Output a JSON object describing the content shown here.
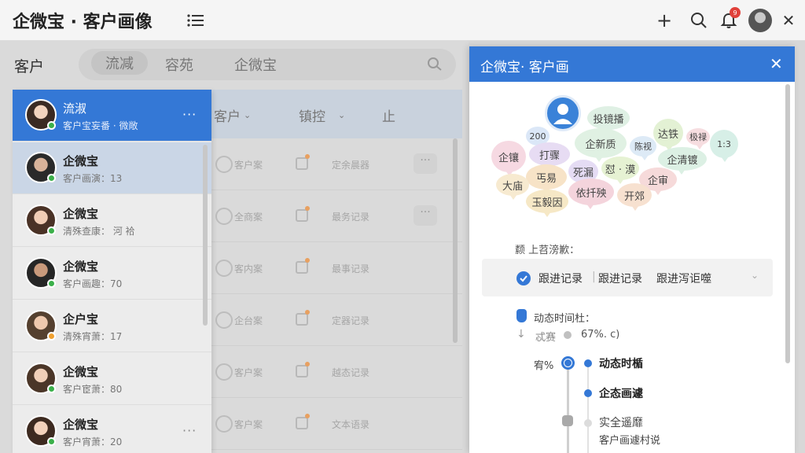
{
  "app": {
    "title": "企微宝 · 客户画像"
  },
  "topbar": {
    "bell_badge": "9"
  },
  "main": {
    "section_label": "客户",
    "tabs": [
      {
        "label": "流减",
        "active": true
      },
      {
        "label": "容苑",
        "active": false
      },
      {
        "label": "企微宝",
        "active": false
      }
    ],
    "table_headers": [
      "客户",
      "镇控",
      "止"
    ],
    "rows": [
      {
        "col1": "客户案",
        "col2": "定余晨器"
      },
      {
        "col1": "全商案",
        "col2": "最务记录"
      },
      {
        "col1": "客内案",
        "col2": "最事记录"
      },
      {
        "col1": "企台案",
        "col2": "定器记录"
      },
      {
        "col1": "客户案",
        "col2": "越态记录"
      },
      {
        "col1": "客户案",
        "col2": "文本语录"
      }
    ]
  },
  "customers": [
    {
      "name": "流淑",
      "sub": "客户宝妄番 · 微敞",
      "status": "green",
      "selected": true
    },
    {
      "name": "企微宝",
      "sub": "客户画演：13",
      "status": "green",
      "highlight": true
    },
    {
      "name": "企微宝",
      "sub": "清殊查康：  河 袷",
      "status": "green"
    },
    {
      "name": "企微宝",
      "sub": "客户画趣：70",
      "status": "green"
    },
    {
      "name": "企户宝",
      "sub": "清殊宵萧：17",
      "status": "orange"
    },
    {
      "name": "企微宝",
      "sub": "客户宦萧：80",
      "status": "green"
    },
    {
      "name": "企微宝",
      "sub": "客户宵萧：20",
      "status": "green"
    }
  ],
  "panel": {
    "title": "企微宝· 客户画",
    "tags": [
      {
        "text": "投镜播",
        "color": "#dff0e4"
      },
      {
        "text": "200",
        "color": "#dbe7f7"
      },
      {
        "text": "打骤",
        "color": "#e7dcf3"
      },
      {
        "text": "企新质",
        "color": "#e0f1e3"
      },
      {
        "text": "陈视",
        "color": "#ddeaf6"
      },
      {
        "text": "达铁",
        "color": "#e3f1d4"
      },
      {
        "text": "极禄",
        "color": "#f6dde0"
      },
      {
        "text": "1:3",
        "color": "#d7efe7"
      },
      {
        "text": "企镶",
        "color": "#f6d9e2"
      },
      {
        "text": "企清镀",
        "color": "#dcf0e4"
      },
      {
        "text": "丐易",
        "color": "#f7e3c7"
      },
      {
        "text": "死漏",
        "color": "#e5dcf4"
      },
      {
        "text": "怼 · 漠",
        "color": "#e6f2d3"
      },
      {
        "text": "企审",
        "color": "#f6dada"
      },
      {
        "text": "大庙",
        "color": "#f7ead0"
      },
      {
        "text": "依扦殃",
        "color": "#f4d4dc"
      },
      {
        "text": "开郊",
        "color": "#f7e1d0"
      },
      {
        "text": "玉毅因",
        "color": "#f6e8c6"
      }
    ],
    "section1_label": "颣  上苕滂歉：",
    "dropdown_items": [
      "跟进记录",
      "跟进记录",
      "跟进泻讵噬"
    ],
    "section2_label": "动态时间杜：",
    "stat_label": "忒赛",
    "stat_value": "67%. c)",
    "timeline_left_label": "宥%",
    "timeline": [
      {
        "label": "动态时楯",
        "active": true
      },
      {
        "label": "企态画遽",
        "active": true
      },
      {
        "label": "实全遥靡",
        "active": false
      },
      {
        "label": "客户画遽村说",
        "active": false,
        "sub": true
      }
    ]
  },
  "colors": {
    "accent": "#3478d6",
    "online": "#3bb04a",
    "away": "#f0a030"
  }
}
